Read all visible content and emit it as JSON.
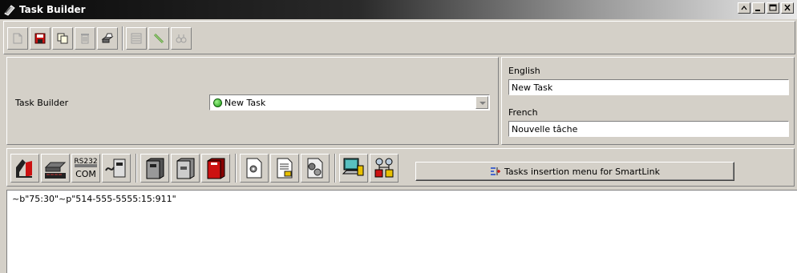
{
  "window": {
    "title": "Task Builder"
  },
  "toolbar1": {
    "buttons": [
      "new-icon",
      "save-icon",
      "copy-icon",
      "delete-icon",
      "print-icon",
      "list-icon",
      "link-icon",
      "find-icon"
    ]
  },
  "header": {
    "task_builder_label": "Task Builder",
    "task_combo_value": "New Task",
    "english_label": "English",
    "english_value": "New Task",
    "french_label": "French",
    "french_value": "Nouvelle tâche"
  },
  "toolbar2": {
    "rs232_line1": "RS232",
    "rs232_line2": "COM",
    "insert_menu_label": "Tasks insertion menu for SmartLink"
  },
  "editor": {
    "content": "~b\"75:30\"~p\"514-555-5555:15:911\""
  },
  "colors": {
    "face": "#d4d0c8",
    "save_red": "#cc1111",
    "status_green": "#1d9a15"
  }
}
